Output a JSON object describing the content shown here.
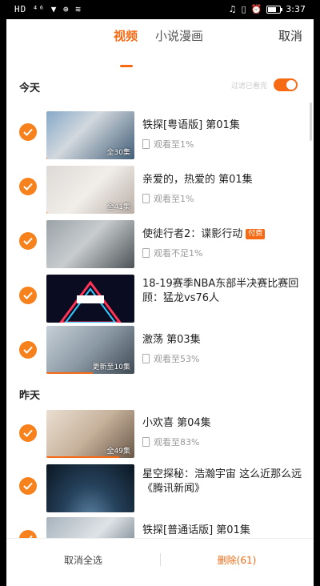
{
  "statusbar": {
    "left": "HD ⁴⁶ ▼ ⊕ ≋",
    "time": "3:37"
  },
  "header": {
    "tabs": [
      {
        "label": "视频"
      },
      {
        "label": "小说漫画"
      }
    ],
    "cancel_label": "取消"
  },
  "filter": {
    "label": "过滤已看完",
    "enabled": true
  },
  "sections": {
    "today": "今天",
    "yesterday": "昨天"
  },
  "items": [
    {
      "title": "铁探[粤语版] 第01集",
      "meta": "观看至1%",
      "thumb_label": "全30集",
      "selected": true,
      "progress": 0.01
    },
    {
      "title": "亲爱的，热爱的 第01集",
      "meta": "观看至1%",
      "thumb_label": "全41集",
      "selected": true,
      "progress": 0.01
    },
    {
      "title": "使徒行者2：谍影行动",
      "badge": "付费",
      "meta": "观看不足1%",
      "thumb_label": "",
      "selected": true,
      "progress": 0.0
    },
    {
      "title": "18-19赛季NBA东部半决赛比赛回顾：猛龙vs76人",
      "meta": "",
      "thumb_label": "",
      "selected": true,
      "progress": 0.0
    },
    {
      "title": "激荡 第03集",
      "meta": "观看至53%",
      "thumb_label": "更新至10集",
      "selected": true,
      "progress": 0.53
    },
    {
      "title": "小欢喜 第04集",
      "meta": "观看至83%",
      "thumb_label": "全49集",
      "selected": true,
      "progress": 0.83
    },
    {
      "title": "星空探秘：浩瀚宇宙 这么近那么远《腾讯新闻》",
      "meta": "",
      "thumb_label": "",
      "selected": true,
      "progress": 0.0
    },
    {
      "title": "铁探[普通话版] 第01集",
      "meta": "",
      "thumb_label": "",
      "selected": true,
      "progress": 0.0
    }
  ],
  "bottom": {
    "deselect_all": "取消全选",
    "delete": "删除(61)"
  },
  "colors": {
    "accent": "#f56a13"
  }
}
